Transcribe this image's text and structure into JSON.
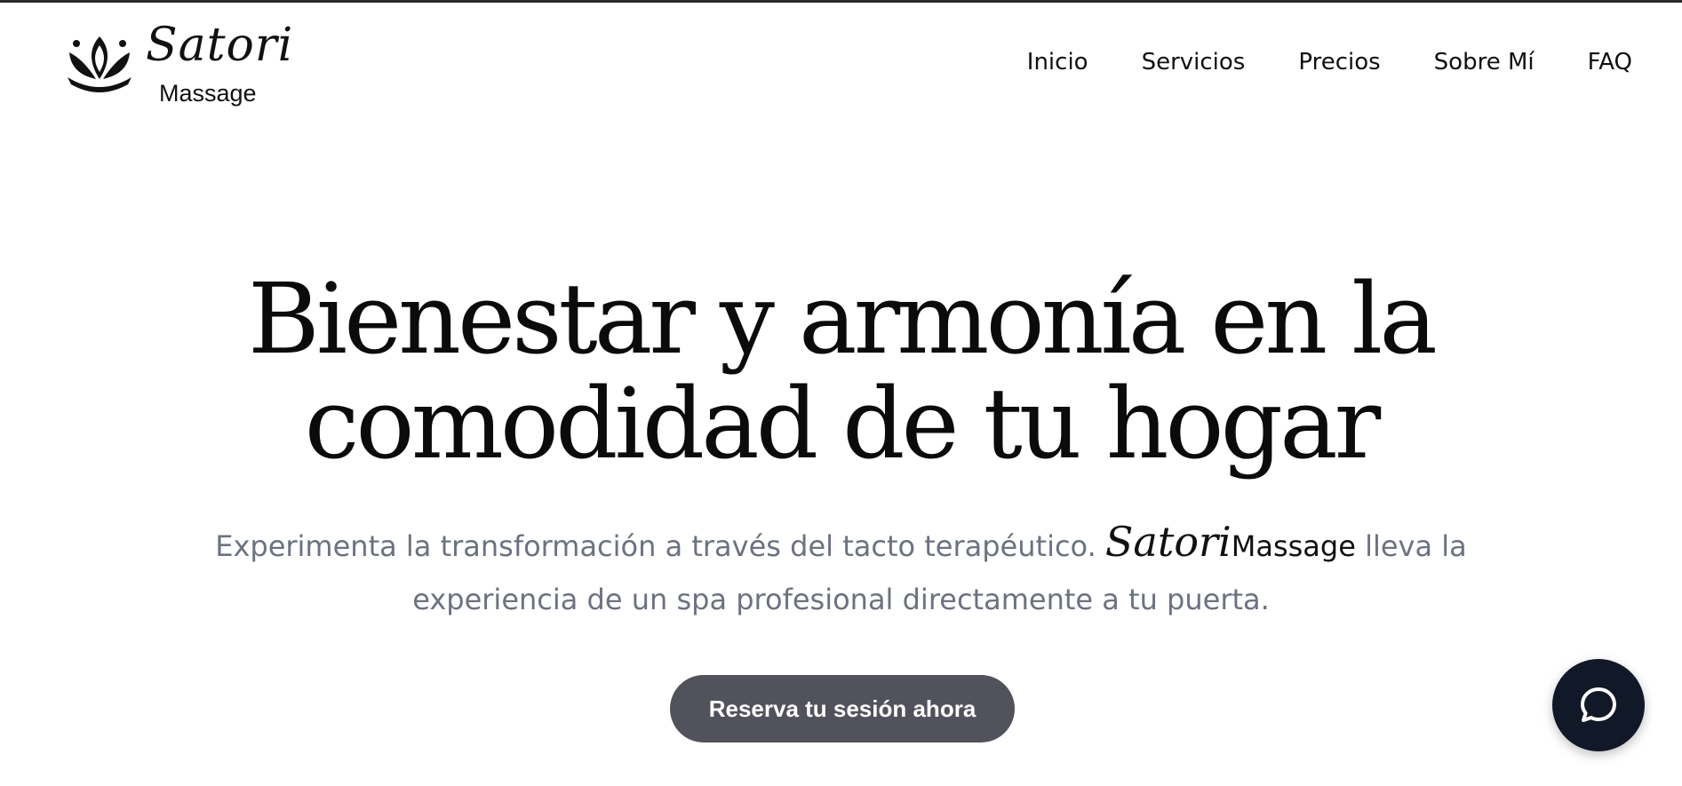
{
  "brand": {
    "script_name": "Satori",
    "sub_name": "Massage"
  },
  "nav": {
    "items": [
      {
        "label": "Inicio"
      },
      {
        "label": "Servicios"
      },
      {
        "label": "Precios"
      },
      {
        "label": "Sobre Mí"
      },
      {
        "label": "FAQ"
      }
    ]
  },
  "hero": {
    "title_line1": "Bienestar y armonía en la",
    "title_line2": "comodidad de tu hogar",
    "subtitle_before": "Experimenta la transformación a través del tacto terapéutico.",
    "subtitle_brand_script": "Satori",
    "subtitle_brand_word": "Massage",
    "subtitle_after": "lleva la experiencia de un spa profesional directamente a tu puerta.",
    "cta_label": "Reserva tu sesión ahora"
  },
  "chat": {
    "icon": "chat-bubble-icon"
  },
  "colors": {
    "text": "#111111",
    "subtitle": "#6b7280",
    "cta_bg": "#51525b",
    "chat_bg": "#111827"
  }
}
